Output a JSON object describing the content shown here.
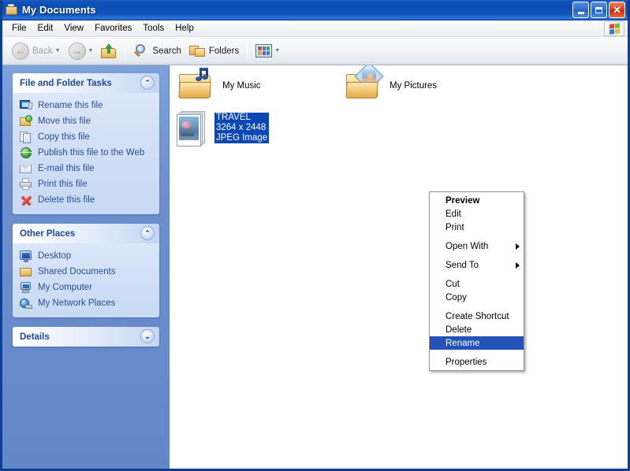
{
  "window": {
    "title": "My Documents",
    "title_icon": "my-documents-folder-icon",
    "minimize_label": "",
    "maximize_label": "",
    "close_label": "✕"
  },
  "menubar": {
    "items": [
      {
        "label": "File"
      },
      {
        "label": "Edit"
      },
      {
        "label": "View"
      },
      {
        "label": "Favorites"
      },
      {
        "label": "Tools"
      },
      {
        "label": "Help"
      }
    ],
    "logo_icon": "windows-flag-icon"
  },
  "toolbar": {
    "back_label": "Back",
    "back_icon": "back-arrow-icon",
    "back_disabled": true,
    "forward_icon": "forward-arrow-icon",
    "up_icon": "up-folder-icon",
    "search_label": "Search",
    "search_icon": "magnifier-icon",
    "folders_label": "Folders",
    "folders_icon": "folders-icon",
    "views_icon": "views-icon",
    "dropdown_icon": "chevron-down-icon"
  },
  "sidebar": {
    "panels": [
      {
        "title": "File and Folder Tasks",
        "collapse_icon": "chevron-up-icon",
        "collapsed": false,
        "items": [
          {
            "label": "Rename this file",
            "icon": "rename-icon"
          },
          {
            "label": "Move this file",
            "icon": "move-icon"
          },
          {
            "label": "Copy this file",
            "icon": "copy-icon"
          },
          {
            "label": "Publish this file to the Web",
            "icon": "publish-web-icon"
          },
          {
            "label": "E-mail this file",
            "icon": "email-icon"
          },
          {
            "label": "Print this file",
            "icon": "print-icon"
          },
          {
            "label": "Delete this file",
            "icon": "delete-icon"
          }
        ]
      },
      {
        "title": "Other Places",
        "collapse_icon": "chevron-up-icon",
        "collapsed": false,
        "items": [
          {
            "label": "Desktop",
            "icon": "desktop-icon"
          },
          {
            "label": "Shared Documents",
            "icon": "shared-folder-icon"
          },
          {
            "label": "My Computer",
            "icon": "my-computer-icon"
          },
          {
            "label": "My Network Places",
            "icon": "network-places-icon"
          }
        ]
      },
      {
        "title": "Details",
        "collapse_icon": "chevron-down-icon",
        "collapsed": true,
        "items": []
      }
    ]
  },
  "content": {
    "items": [
      {
        "name": "My Music",
        "icon": "my-music-folder-icon",
        "type": "folder",
        "selected": false
      },
      {
        "name": "My Pictures",
        "icon": "my-pictures-folder-icon",
        "type": "folder",
        "selected": false
      },
      {
        "name": "TRAVEL",
        "dimensions": "3264 x 2448",
        "kind": "JPEG Image",
        "icon": "jpeg-image-icon",
        "type": "file",
        "selected": true
      }
    ]
  },
  "context_menu": {
    "groups": [
      {
        "items": [
          {
            "label": "Preview",
            "bold": true,
            "submenu": false,
            "selected": false
          },
          {
            "label": "Edit",
            "bold": false,
            "submenu": false,
            "selected": false
          },
          {
            "label": "Print",
            "bold": false,
            "submenu": false,
            "selected": false
          }
        ]
      },
      {
        "items": [
          {
            "label": "Open With",
            "bold": false,
            "submenu": true,
            "selected": false
          }
        ]
      },
      {
        "items": [
          {
            "label": "Send To",
            "bold": false,
            "submenu": true,
            "selected": false
          }
        ]
      },
      {
        "items": [
          {
            "label": "Cut",
            "bold": false,
            "submenu": false,
            "selected": false
          },
          {
            "label": "Copy",
            "bold": false,
            "submenu": false,
            "selected": false
          }
        ]
      },
      {
        "items": [
          {
            "label": "Create Shortcut",
            "bold": false,
            "submenu": false,
            "selected": false
          },
          {
            "label": "Delete",
            "bold": false,
            "submenu": false,
            "selected": false
          },
          {
            "label": "Rename",
            "bold": false,
            "submenu": false,
            "selected": true
          }
        ]
      },
      {
        "items": [
          {
            "label": "Properties",
            "bold": false,
            "submenu": false,
            "selected": false
          }
        ]
      }
    ]
  },
  "colors": {
    "titlebar_blue": "#0b4cb0",
    "sidebar_blue": "#6d8fce",
    "panel_body": "#d2e0f7",
    "link_blue": "#2a4d99",
    "selection_blue": "#0b47b5",
    "menu_highlight": "#2453b8",
    "window_border": "#0e3d91",
    "content_white": "#ffffff"
  }
}
